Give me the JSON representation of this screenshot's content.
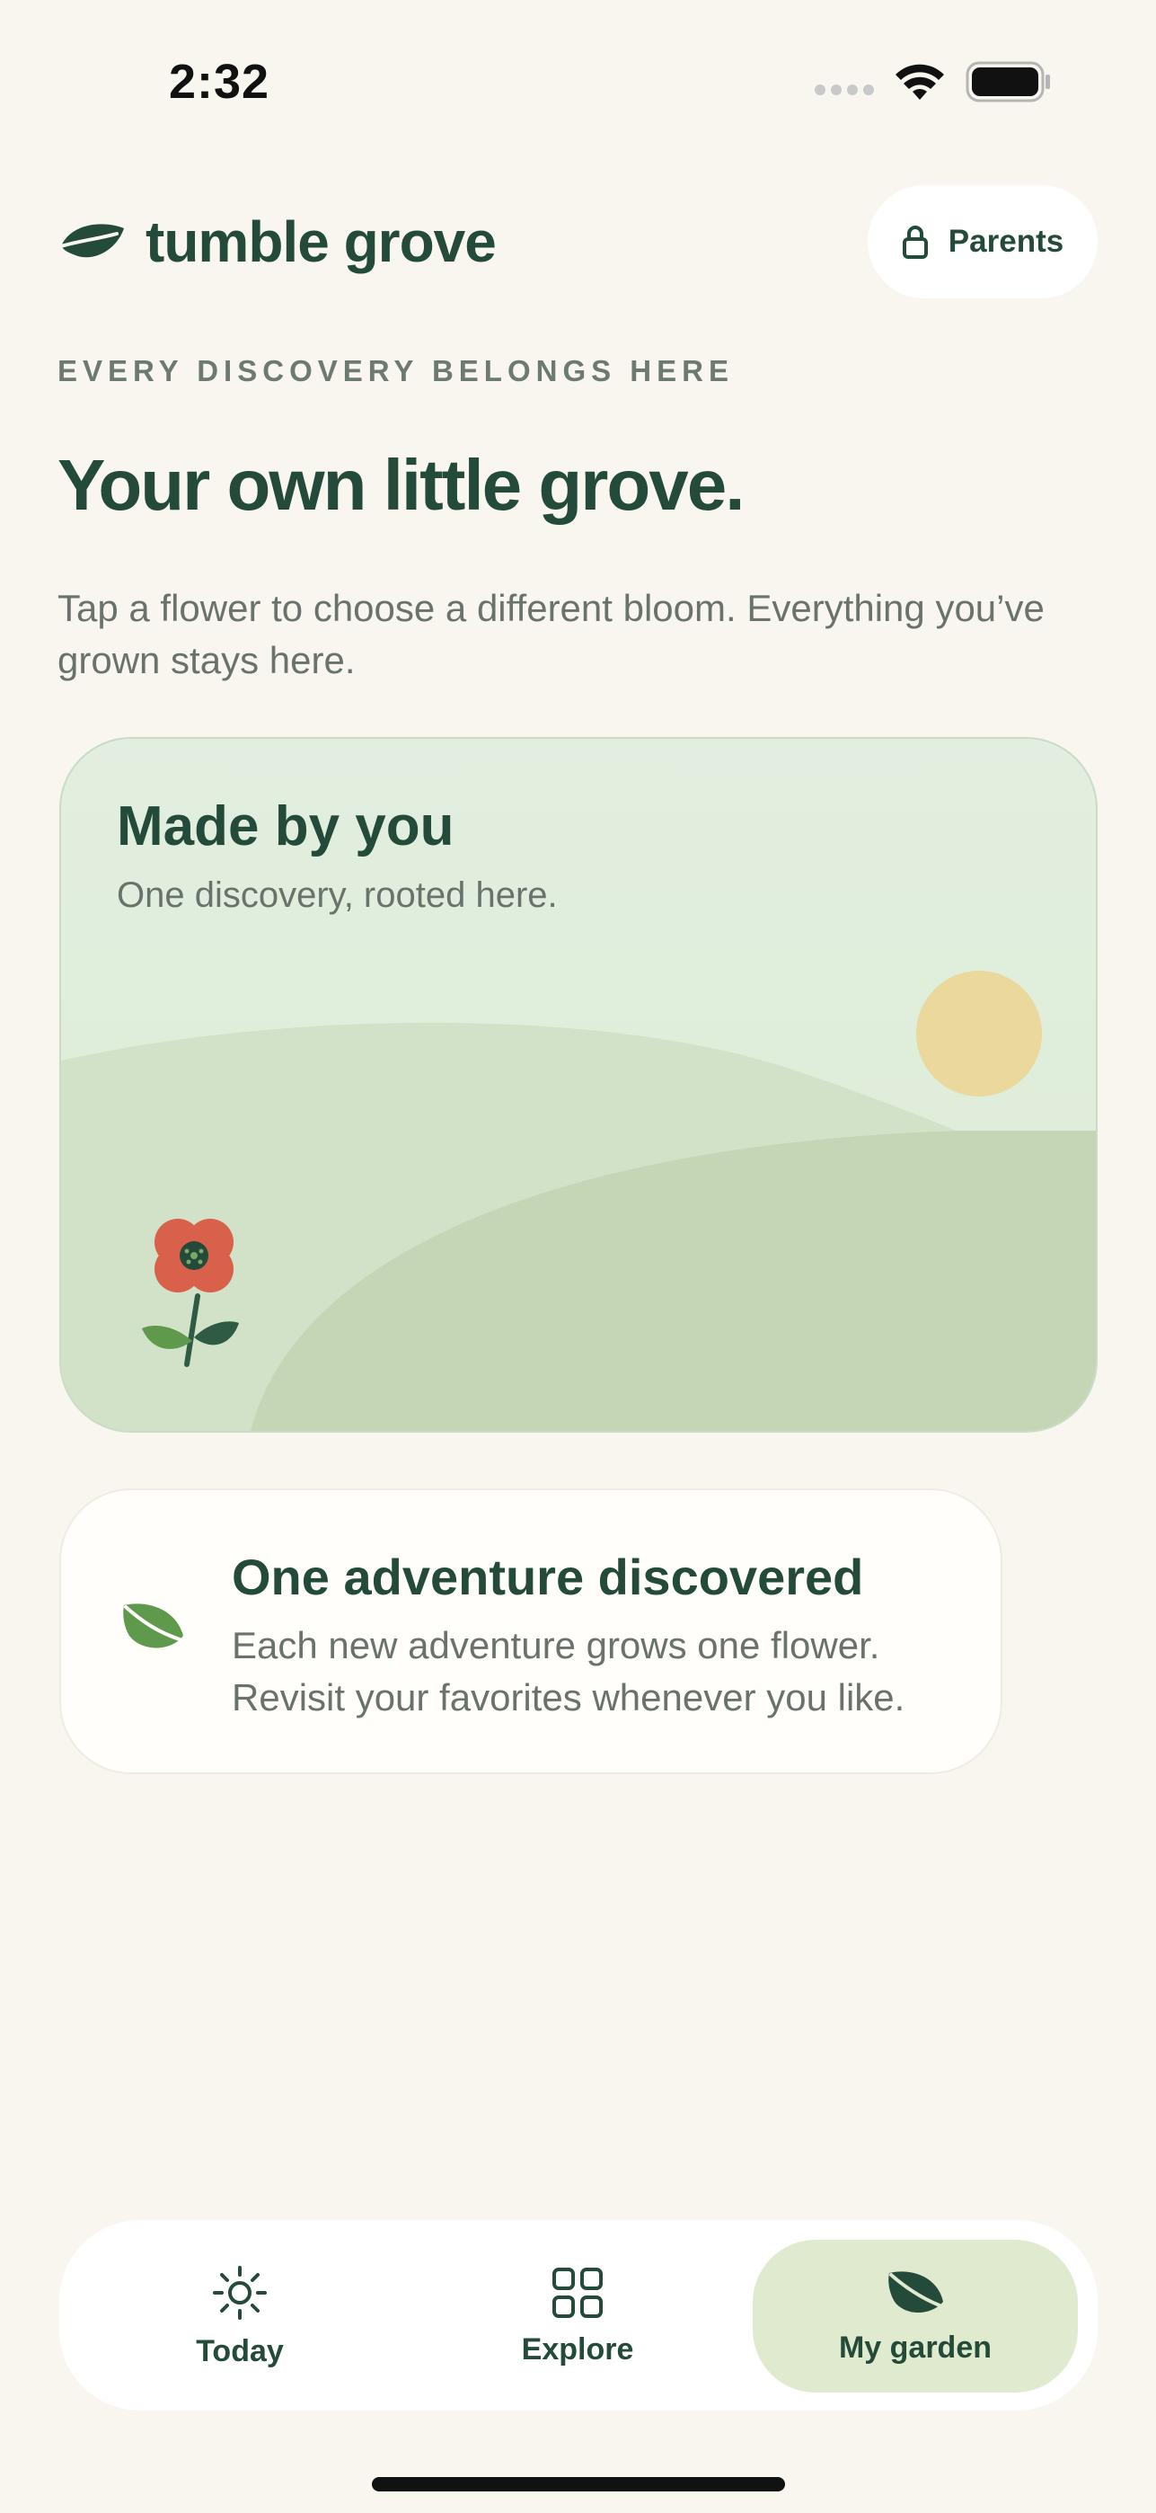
{
  "status_bar": {
    "time": "2:32"
  },
  "header": {
    "brand": "tumble grove",
    "parents_label": "Parents"
  },
  "hero": {
    "eyebrow": "EVERY DISCOVERY BELONGS HERE",
    "headline": "Your own little grove.",
    "intro": "Tap a flower to choose a different bloom. Everything you’ve grown stays here."
  },
  "garden_card": {
    "title": "Made by you",
    "subtitle": "One discovery, rooted here."
  },
  "info_card": {
    "title": "One adventure discovered",
    "text": "Each new adventure grows one flower. Revisit your favorites whenever you like."
  },
  "tabs": [
    {
      "label": "Today",
      "icon": "sun-icon",
      "active": false
    },
    {
      "label": "Explore",
      "icon": "grid-icon",
      "active": false
    },
    {
      "label": "My garden",
      "icon": "leaf-icon",
      "active": true
    }
  ],
  "colors": {
    "background": "#f9f6f0",
    "brand_green": "#244a3a",
    "card_green": "#e2efe0",
    "hill_green": "#c8d8bb",
    "sun": "#ebd89c",
    "flower_red": "#d9604a",
    "tab_active": "#dfeacf"
  }
}
